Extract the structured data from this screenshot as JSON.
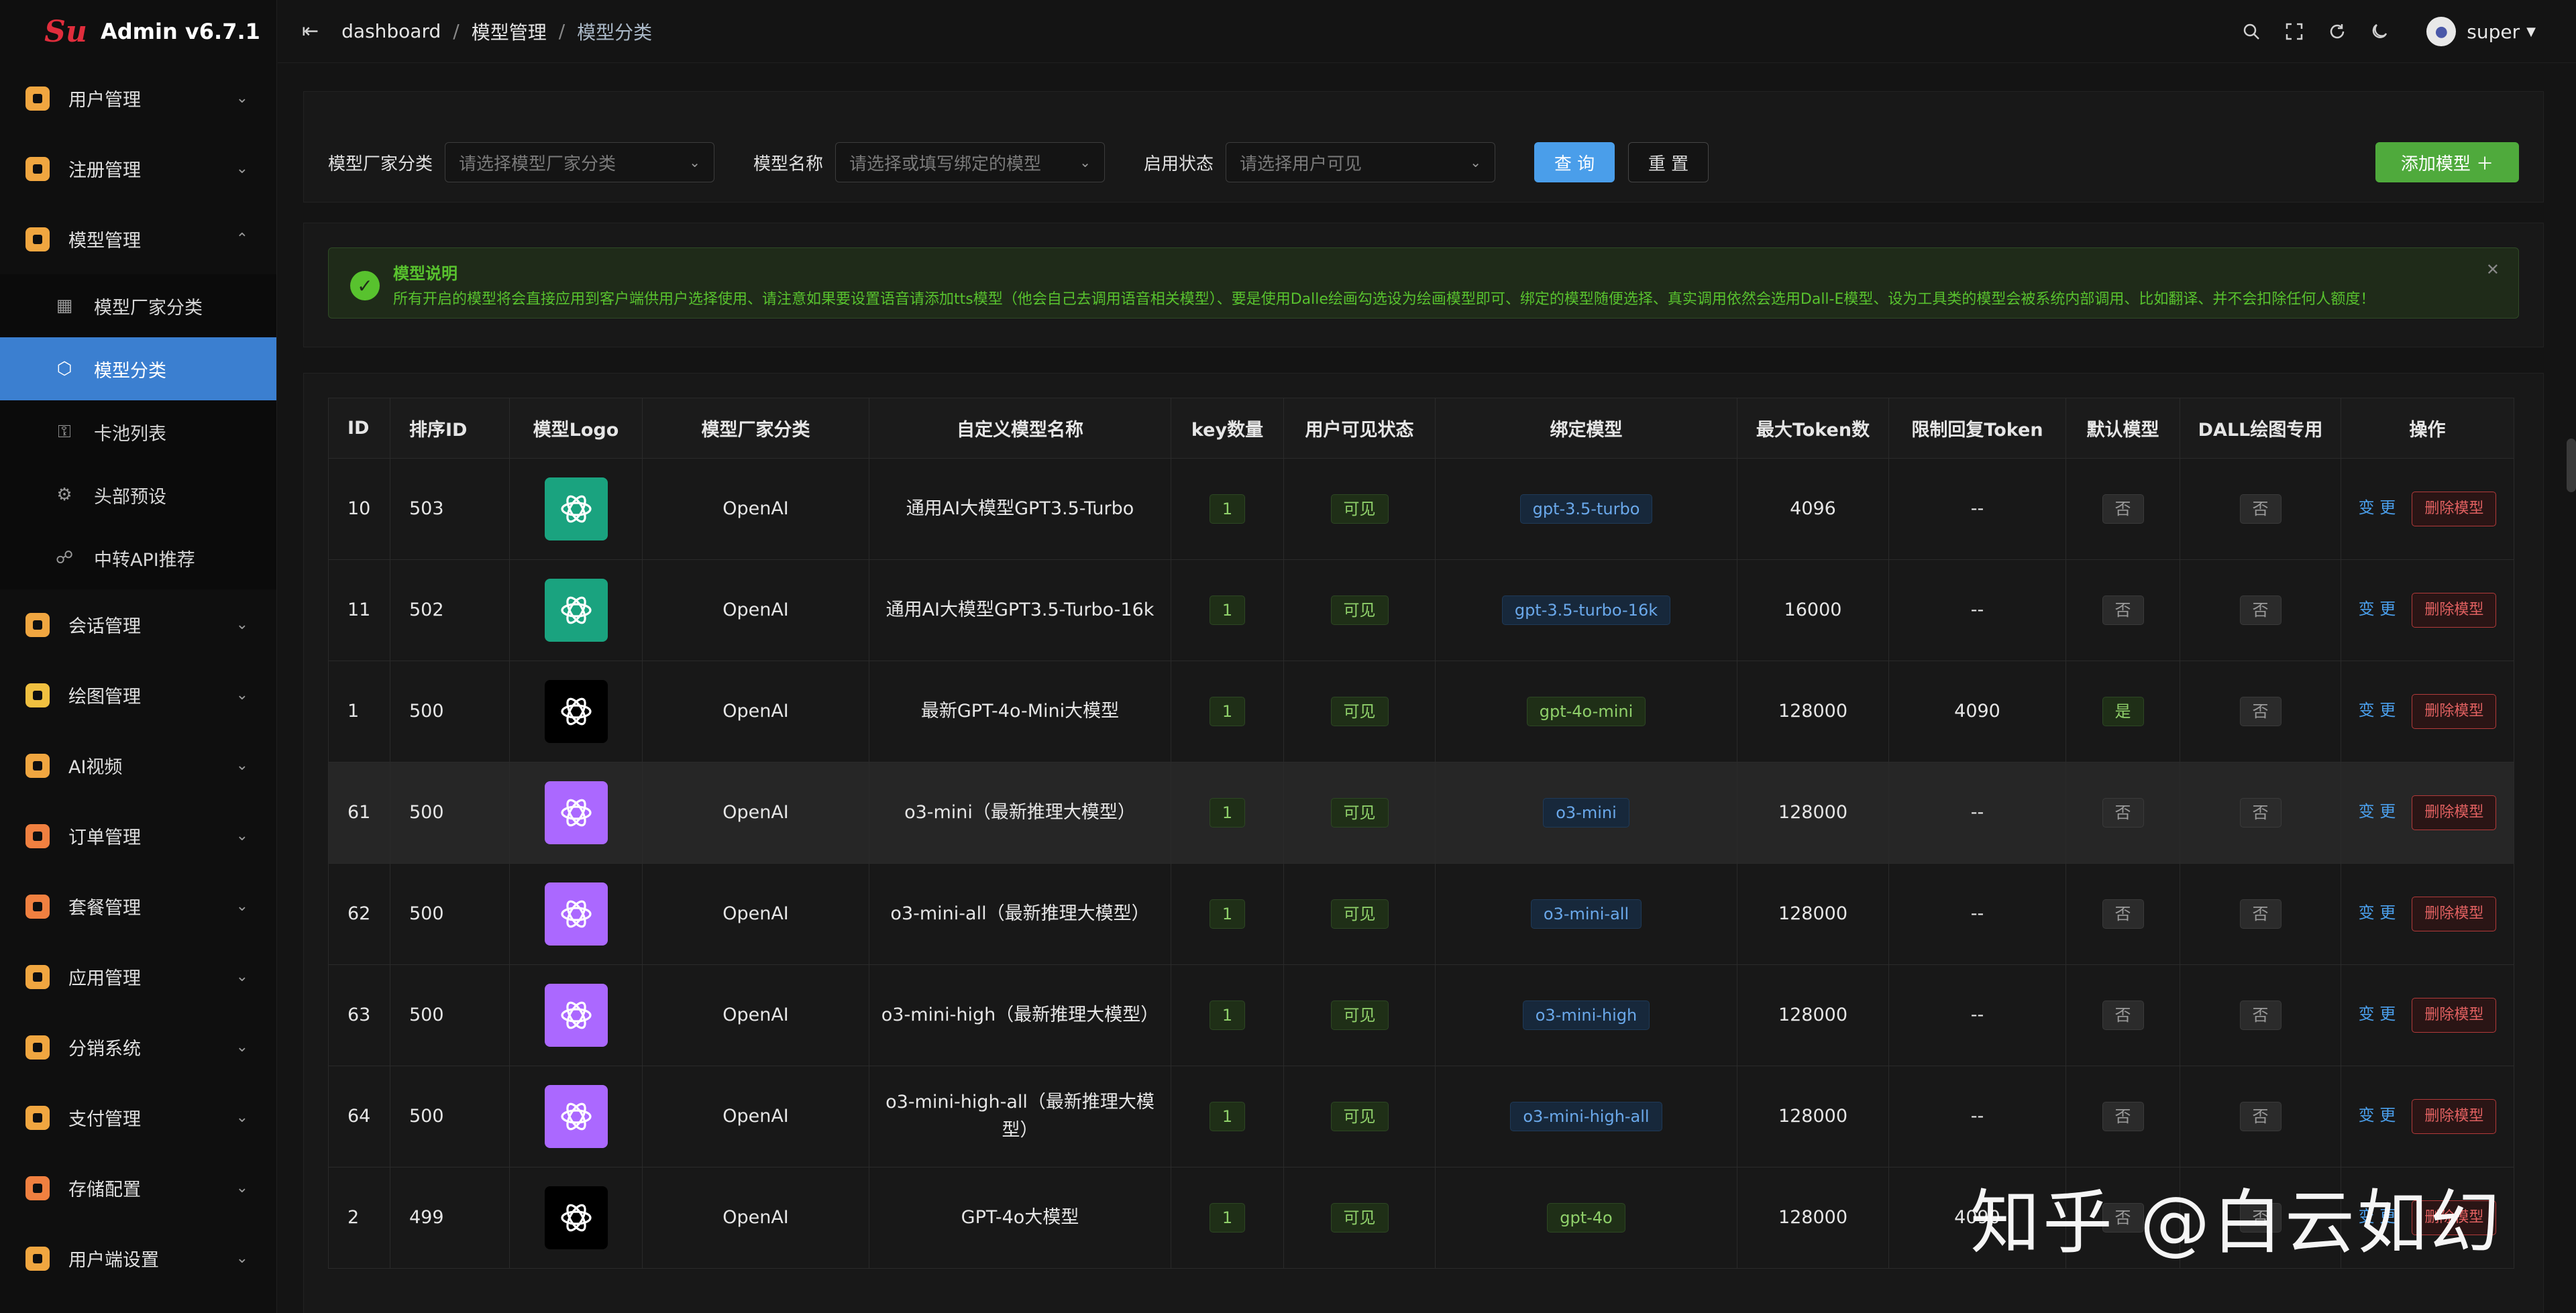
{
  "brand": {
    "logo_text": "Su",
    "title": "Admin v6.7.1"
  },
  "sidebar": {
    "items": [
      {
        "label": "用户管理",
        "icon": "user-card-icon",
        "color": "#f0a640"
      },
      {
        "label": "注册管理",
        "icon": "register-icon",
        "color": "#f0a640"
      },
      {
        "label": "模型管理",
        "icon": "model-icon",
        "color": "#f0a640",
        "expanded": true,
        "children": [
          {
            "label": "模型厂家分类",
            "icon": "grid-icon"
          },
          {
            "label": "模型分类",
            "icon": "cube-icon",
            "active": true
          },
          {
            "label": "卡池列表",
            "icon": "key-icon"
          },
          {
            "label": "头部预设",
            "icon": "preset-icon"
          },
          {
            "label": "中转API推荐",
            "icon": "share-icon"
          }
        ]
      },
      {
        "label": "会话管理",
        "icon": "chat-icon",
        "color": "#f0a640"
      },
      {
        "label": "绘图管理",
        "icon": "palette-icon",
        "color": "#f0c040"
      },
      {
        "label": "AI视频",
        "icon": "video-icon",
        "color": "#f0a640"
      },
      {
        "label": "订单管理",
        "icon": "order-icon",
        "color": "#f08040"
      },
      {
        "label": "套餐管理",
        "icon": "package-icon",
        "color": "#f08040"
      },
      {
        "label": "应用管理",
        "icon": "apps-icon",
        "color": "#f0a640"
      },
      {
        "label": "分销系统",
        "icon": "distribution-icon",
        "color": "#f0a640"
      },
      {
        "label": "支付管理",
        "icon": "payment-icon",
        "color": "#f0a640"
      },
      {
        "label": "存储配置",
        "icon": "storage-icon",
        "color": "#f08040"
      },
      {
        "label": "用户端设置",
        "icon": "settings-icon",
        "color": "#f0a640"
      }
    ]
  },
  "header": {
    "breadcrumb": [
      "dashboard",
      "模型管理",
      "模型分类"
    ],
    "separator": "/",
    "user": "super"
  },
  "filters": {
    "vendor_label": "模型厂家分类",
    "vendor_placeholder": "请选择模型厂家分类",
    "name_label": "模型名称",
    "name_placeholder": "请选择或填写绑定的模型",
    "status_label": "启用状态",
    "status_placeholder": "请选择用户可见",
    "query": "查 询",
    "reset": "重 置",
    "add": "添加模型 ＋"
  },
  "notice": {
    "title": "模型说明",
    "text": "所有开启的模型将会直接应用到客户端供用户选择使用、请注意如果要设置语音请添加tts模型（他会自己去调用语音相关模型）、要是使用Dalle绘画勾选设为绘画模型即可、绑定的模型随便选择、真实调用依然会选用Dall-E模型、设为工具类的模型会被系统内部调用、比如翻译、并不会扣除任何人额度！"
  },
  "table": {
    "columns": [
      "ID",
      "排序ID",
      "模型Logo",
      "模型厂家分类",
      "自定义模型名称",
      "key数量",
      "用户可见状态",
      "绑定模型",
      "最大Token数",
      "限制回复Token",
      "默认模型",
      "DALL绘图专用",
      "操作"
    ],
    "edit_label": "变 更",
    "delete_label": "删除模型",
    "rows": [
      {
        "id": "10",
        "sort": "503",
        "logo": "openai-green",
        "vendor": "OpenAI",
        "name": "通用AI大模型GPT3.5-Turbo",
        "keys": "1",
        "visible": "可见",
        "bind": "gpt-3.5-turbo",
        "bind_style": "blue",
        "max_token": "4096",
        "limit_token": "--",
        "default": "否",
        "dall": "否"
      },
      {
        "id": "11",
        "sort": "502",
        "logo": "openai-green",
        "vendor": "OpenAI",
        "name": "通用AI大模型GPT3.5-Turbo-16k",
        "keys": "1",
        "visible": "可见",
        "bind": "gpt-3.5-turbo-16k",
        "bind_style": "blue",
        "max_token": "16000",
        "limit_token": "--",
        "default": "否",
        "dall": "否"
      },
      {
        "id": "1",
        "sort": "500",
        "logo": "openai-black",
        "vendor": "OpenAI",
        "name": "最新GPT-4o-Mini大模型",
        "keys": "1",
        "visible": "可见",
        "bind": "gpt-4o-mini",
        "bind_style": "green",
        "max_token": "128000",
        "limit_token": "4090",
        "default": "是",
        "dall": "否"
      },
      {
        "id": "61",
        "sort": "500",
        "logo": "openai-purple",
        "vendor": "OpenAI",
        "name": "o3-mini（最新推理大模型）",
        "keys": "1",
        "visible": "可见",
        "bind": "o3-mini",
        "bind_style": "blue",
        "max_token": "128000",
        "limit_token": "--",
        "default": "否",
        "dall": "否",
        "highlight": true
      },
      {
        "id": "62",
        "sort": "500",
        "logo": "openai-purple",
        "vendor": "OpenAI",
        "name": "o3-mini-all（最新推理大模型）",
        "keys": "1",
        "visible": "可见",
        "bind": "o3-mini-all",
        "bind_style": "blue",
        "max_token": "128000",
        "limit_token": "--",
        "default": "否",
        "dall": "否"
      },
      {
        "id": "63",
        "sort": "500",
        "logo": "openai-purple",
        "vendor": "OpenAI",
        "name": "o3-mini-high（最新推理大模型）",
        "keys": "1",
        "visible": "可见",
        "bind": "o3-mini-high",
        "bind_style": "blue",
        "max_token": "128000",
        "limit_token": "--",
        "default": "否",
        "dall": "否"
      },
      {
        "id": "64",
        "sort": "500",
        "logo": "openai-purple",
        "vendor": "OpenAI",
        "name": "o3-mini-high-all（最新推理大模型）",
        "keys": "1",
        "visible": "可见",
        "bind": "o3-mini-high-all",
        "bind_style": "blue",
        "max_token": "128000",
        "limit_token": "--",
        "default": "否",
        "dall": "否"
      },
      {
        "id": "2",
        "sort": "499",
        "logo": "openai-black",
        "vendor": "OpenAI",
        "name": "GPT-4o大模型",
        "keys": "1",
        "visible": "可见",
        "bind": "gpt-4o",
        "bind_style": "green",
        "max_token": "128000",
        "limit_token": "4090",
        "default": "否",
        "dall": "否"
      }
    ]
  },
  "watermark": "知乎 @白云如幻"
}
